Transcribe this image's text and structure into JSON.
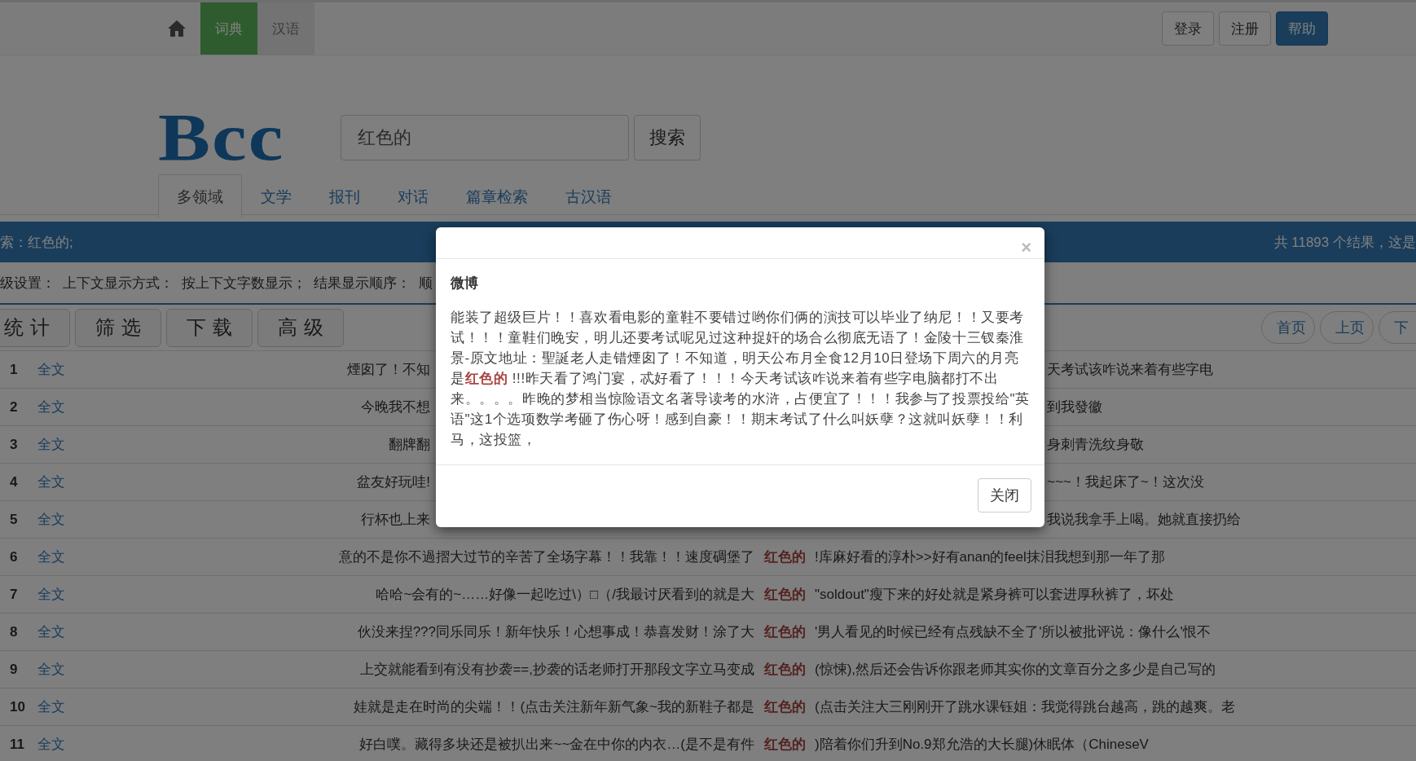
{
  "top_nav": {
    "tabs": [
      {
        "label": "词典",
        "selected": true
      },
      {
        "label": "汉语",
        "selected": false
      }
    ],
    "account_buttons": [
      {
        "label": "登录",
        "kind": "default"
      },
      {
        "label": "注册",
        "kind": "default"
      },
      {
        "label": "帮助",
        "kind": "primary"
      }
    ]
  },
  "logo": {
    "text": "Bcc"
  },
  "search": {
    "value": "红色的",
    "button": "搜索"
  },
  "corpus_tabs": [
    {
      "label": "多领域",
      "selected": true
    },
    {
      "label": "文学",
      "selected": false
    },
    {
      "label": "报刊",
      "selected": false
    },
    {
      "label": "对话",
      "selected": false
    },
    {
      "label": "篇章检索",
      "selected": false
    },
    {
      "label": "古汉语",
      "selected": false
    }
  ],
  "result_bar": {
    "query": "索：红色的;",
    "summary": "共 11893 个结果，这是"
  },
  "settings": "级设置：  上下文显示方式：  按上下文字数显示；  结果显示顺序：  顺",
  "tools": [
    "统计",
    "筛选",
    "下载",
    "高级"
  ],
  "pager": [
    "首页",
    "上页",
    "下"
  ],
  "rows": [
    {
      "number": "1",
      "link": "全文",
      "left": "煙囱了！不知",
      "right": "天考试该咋说来着有些字电"
    },
    {
      "number": "2",
      "link": "全文",
      "left": "今晚我不想",
      "right": "到我發徽"
    },
    {
      "number": "3",
      "link": "全文",
      "left": "翻牌翻",
      "right": "身刺青洗纹身敬"
    },
    {
      "number": "4",
      "link": "全文",
      "left": "盆友好玩哇!",
      "right": "~~~！我起床了~！这次没"
    },
    {
      "number": "5",
      "link": "全文",
      "left": "行杯也上来",
      "right": "我说我拿手上喝。她就直接扔给"
    },
    {
      "number": "6",
      "link": "全文",
      "left": "意的不是你不過摺大过节的辛苦了全场字幕！！我靠！！速度碉堡了",
      "keyword": "红色的",
      "right": "!库麻好看的淳朴>>好有anan的feel抹泪我想到那一年了那"
    },
    {
      "number": "7",
      "link": "全文",
      "left": "哈哈~会有的~……好像一起吃过\\）□（/我最讨厌看到的就是大",
      "keyword": "红色的",
      "right": "\"soldout\"瘦下来的好处就是紧身裤可以套进厚秋裤了，坏处"
    },
    {
      "number": "8",
      "link": "全文",
      "left": "伙没来捏???同乐同乐！新年快乐！心想事成！恭喜发财！涂了大",
      "keyword": "红色的",
      "right": "'男人看见的时候已经有点残缺不全了'所以被批评说：像什么'恨不"
    },
    {
      "number": "9",
      "link": "全文",
      "left": "上交就能看到有没有抄袭==,抄袭的话老师打开那段文字立马变成",
      "keyword": "红色的",
      "right": "(惊悚),然后还会告诉你跟老师其实你的文章百分之多少是自己写的"
    },
    {
      "number": "10",
      "link": "全文",
      "left": "娃就是走在时尚的尖端！！(点击关注新年新气象~我的新鞋子都是",
      "keyword": "红色的",
      "right": "(点击关注大三刚刚开了跳水课钰姐：我觉得跳台越高，跳的越爽。老"
    },
    {
      "number": "11",
      "link": "全文",
      "left": "好白噗。藏得多块还是被扒出来~~金在中你的内衣…(是不是有件",
      "keyword": "红色的",
      "right": ")陪着你们升到No.9郑允浩的大长腿)休眠体（ChineseV"
    }
  ],
  "dialog": {
    "close_symbol": "×",
    "source": "微博",
    "text": "能装了超级巨片！！喜欢看电影的童鞋不要错过哟你们俩的演技可以毕业了纳尼！！又要考试！！！童鞋们晚安，明儿还要考试呢见过这种捉奸的场合么彻底无语了！金陵十三钗秦淮景-原文地址：聖誕老人走错煙囱了！不知道，明天公布月全食12月10日登场下周六的月亮是**红色的** !!!昨天看了鸿门宴，忒好看了！！！今天考试该咋说来着有些字电脑都打不出来。。。。昨晚的梦相当惊险语文名著导读考的水浒，占便宜了！！！我参与了投票投给\"英语\"这1个选项数学考砸了伤心呀！感到自豪！！期末考试了什么叫妖孽？这就叫妖孽！！利马，这投篮，",
    "button": "关闭"
  }
}
